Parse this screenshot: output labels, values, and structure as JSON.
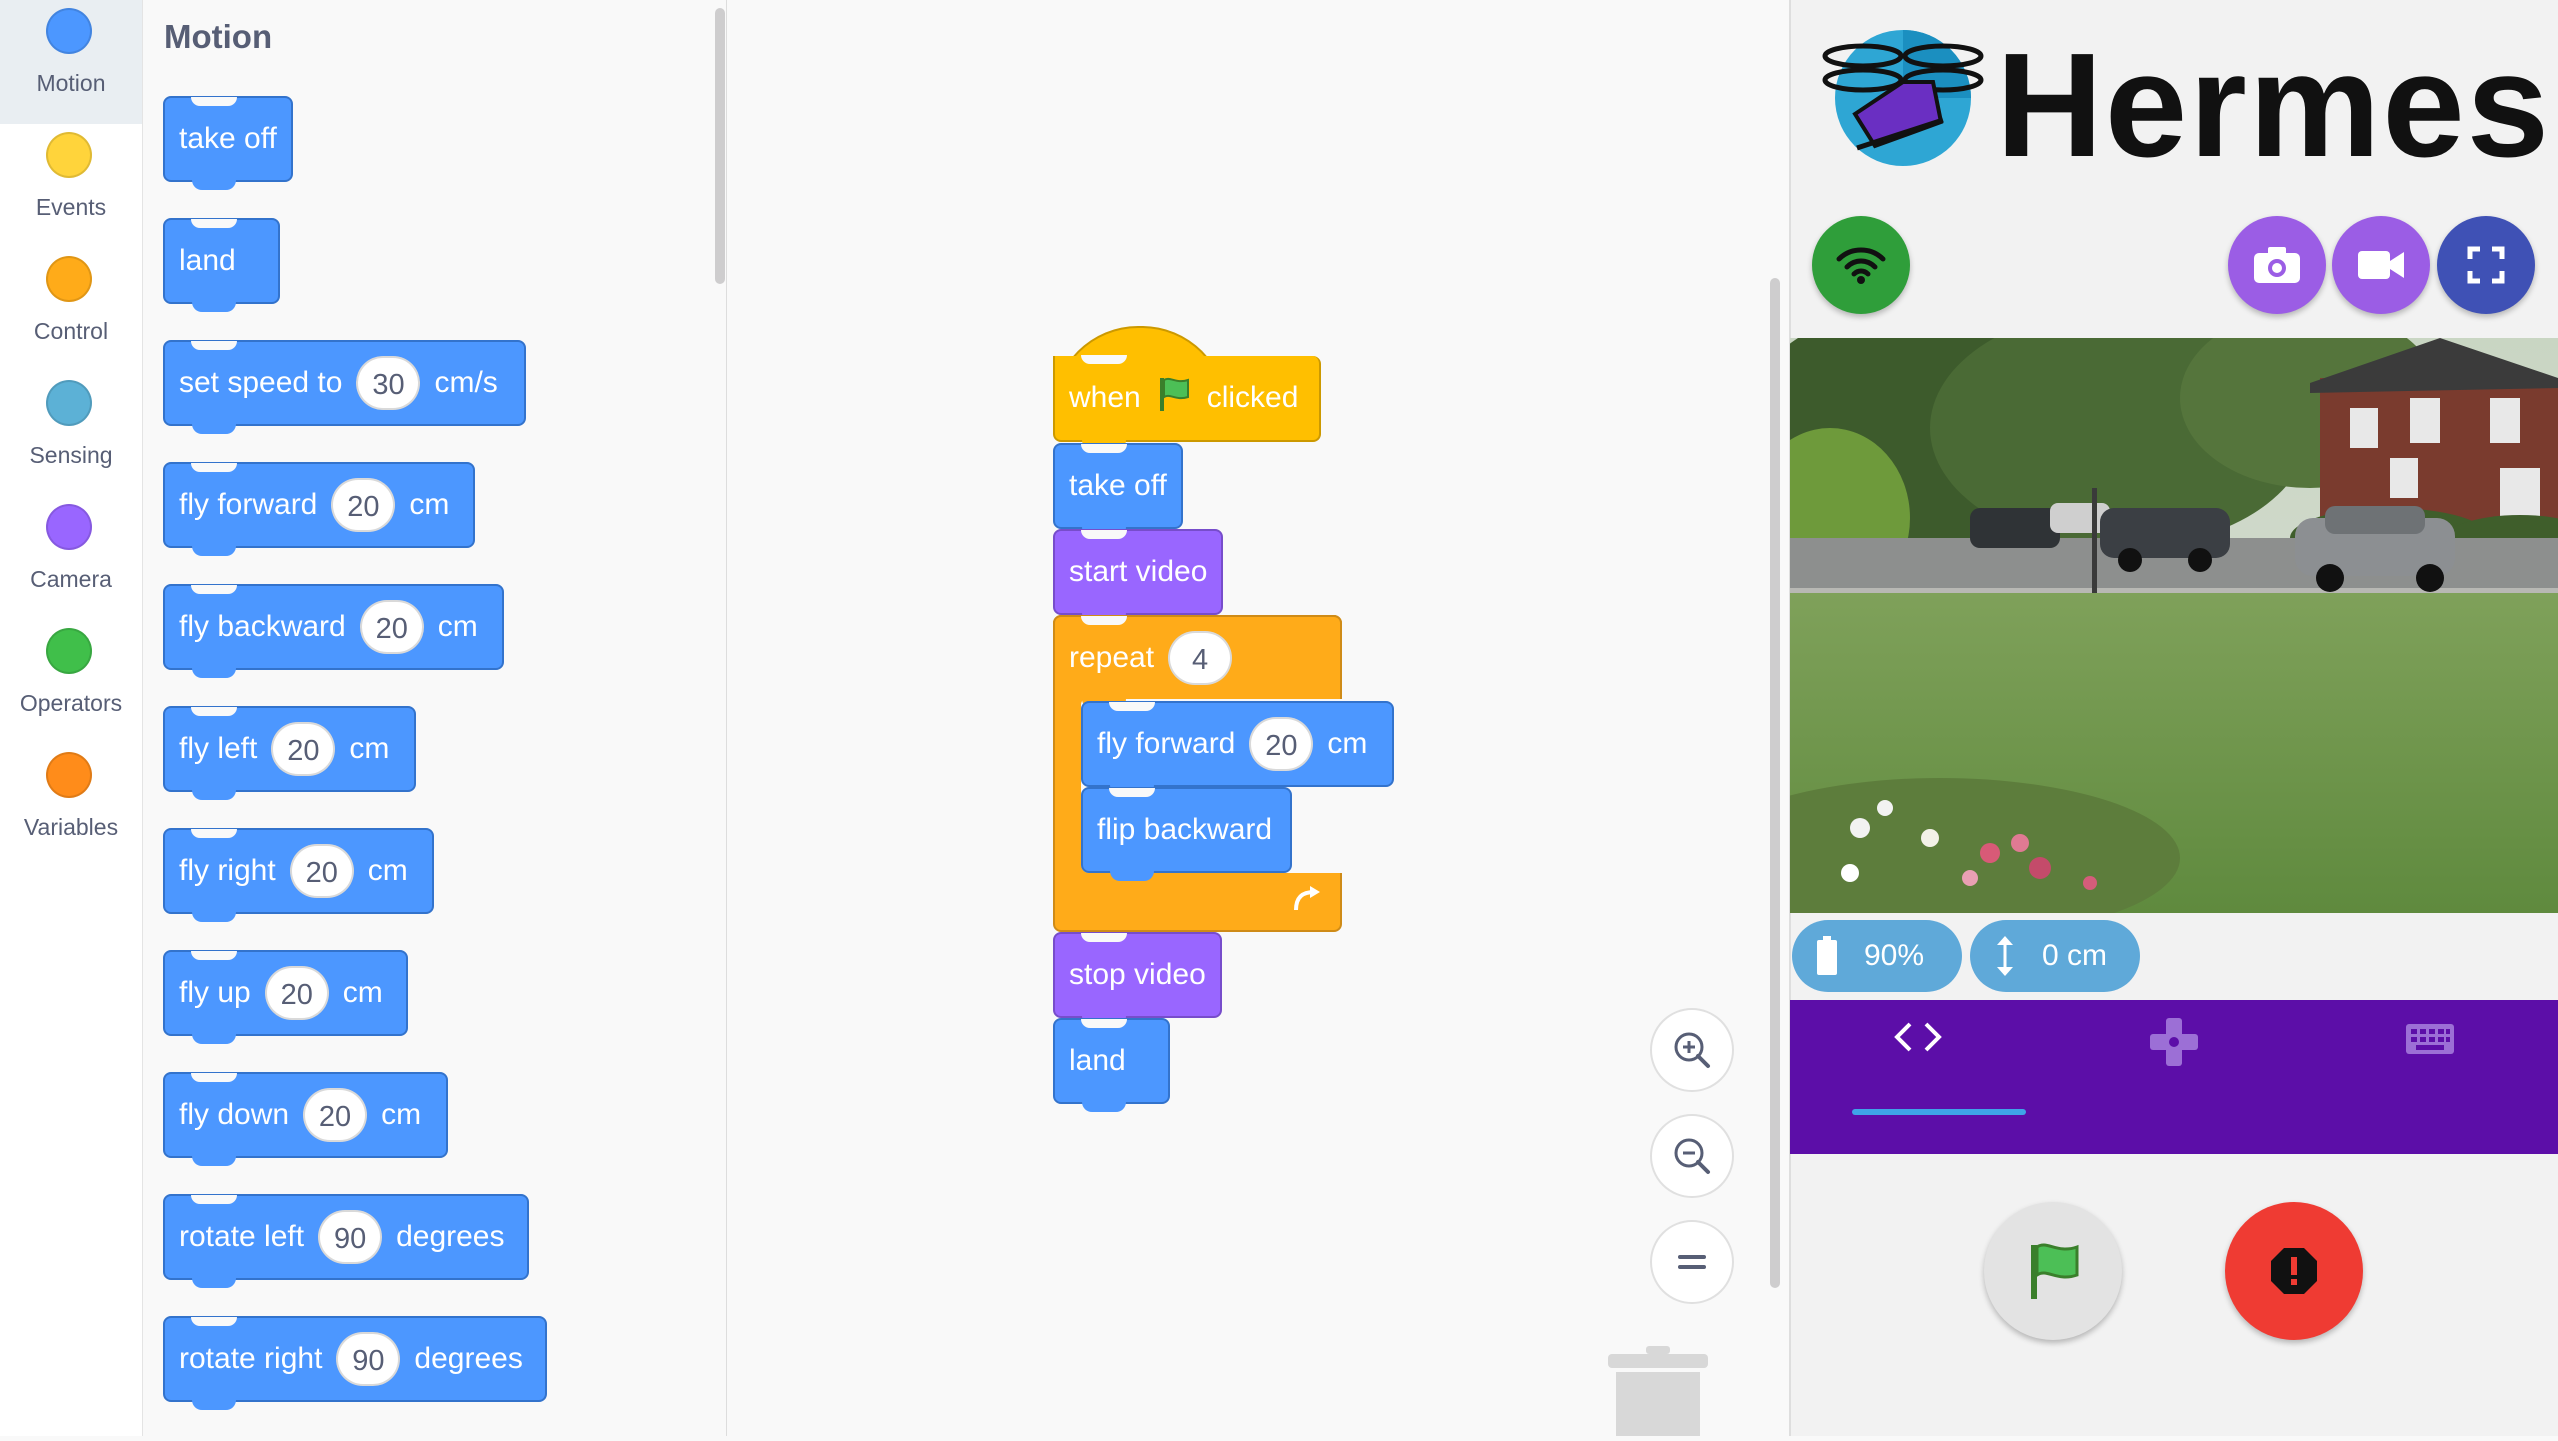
{
  "categories": [
    {
      "label": "Motion",
      "color": "#4c97ff",
      "selected": true
    },
    {
      "label": "Events",
      "color": "#ffd43b"
    },
    {
      "label": "Control",
      "color": "#ffab19"
    },
    {
      "label": "Sensing",
      "color": "#5cb1d6"
    },
    {
      "label": "Camera",
      "color": "#9966ff"
    },
    {
      "label": "Operators",
      "color": "#40bf4a"
    },
    {
      "label": "Variables",
      "color": "#ff8c1a"
    }
  ],
  "flyout": {
    "title": "Motion",
    "blocks": [
      {
        "parts": [
          "take off"
        ]
      },
      {
        "parts": [
          "land"
        ]
      },
      {
        "parts": [
          "set speed to"
        ],
        "value": "30",
        "unit": "cm/s"
      },
      {
        "parts": [
          "fly forward"
        ],
        "value": "20",
        "unit": "cm"
      },
      {
        "parts": [
          "fly backward"
        ],
        "value": "20",
        "unit": "cm"
      },
      {
        "parts": [
          "fly left"
        ],
        "value": "20",
        "unit": "cm"
      },
      {
        "parts": [
          "fly right"
        ],
        "value": "20",
        "unit": "cm"
      },
      {
        "parts": [
          "fly up"
        ],
        "value": "20",
        "unit": "cm"
      },
      {
        "parts": [
          "fly down"
        ],
        "value": "20",
        "unit": "cm"
      },
      {
        "parts": [
          "rotate left"
        ],
        "value": "90",
        "unit": "degrees"
      },
      {
        "parts": [
          "rotate right"
        ],
        "value": "90",
        "unit": "degrees"
      }
    ]
  },
  "script": {
    "hat": {
      "when": "when",
      "clicked": "clicked"
    },
    "take_off": "take off",
    "start_video": "start video",
    "repeat": {
      "label": "repeat",
      "count": "4"
    },
    "fly_forward": {
      "label": "fly forward",
      "value": "20",
      "unit": "cm"
    },
    "flip_backward": "flip backward",
    "stop_video": "stop video",
    "land": "land"
  },
  "zoom": {
    "in_icon": "zoom-in-icon",
    "out_icon": "zoom-out-icon",
    "reset_icon": "zoom-reset-icon"
  },
  "panel": {
    "app_title": "Hermes",
    "battery": "90%",
    "height": "0 cm",
    "tabs": [
      "code",
      "gamepad",
      "keyboard"
    ],
    "active_tab": "code"
  },
  "colors": {
    "motion": "#4c97ff",
    "looks": "#9966ff",
    "events": "#ffbf00",
    "control": "#ffab19",
    "wifi": "#2f9e3a",
    "camera_btn": "#9b5de5",
    "fullscreen_btn": "#3f51b5",
    "tabbar": "#5c0ea8",
    "stop": "#ef3b33"
  }
}
